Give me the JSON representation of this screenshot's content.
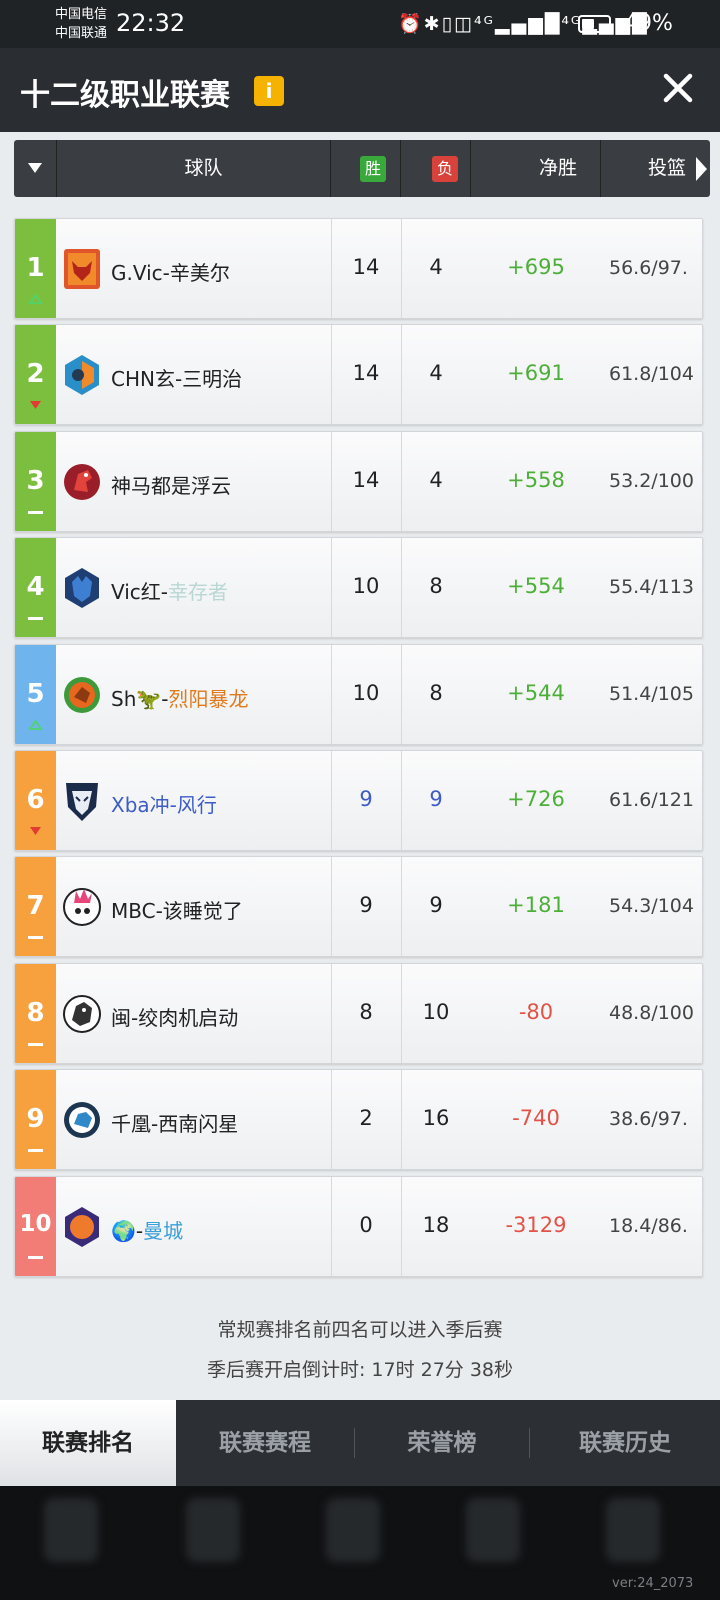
{
  "status_bar": {
    "carrier_1": "中国电信",
    "carrier_2": "中国联通",
    "time": "22:32",
    "icons": "⏰✱▯◫⁴ᴳ▂▄▆█⁴ᴳ▂▄▆█",
    "battery_percent": "49%",
    "battery_level": 0.49
  },
  "header": {
    "title": "十二级职业联赛",
    "info_label": "i"
  },
  "table_header": {
    "team": "球队",
    "wins": "胜",
    "losses": "负",
    "net": "净胜",
    "fg": "投篮"
  },
  "colors": {
    "tier_green": "#7cbf3e",
    "tier_blue": "#6fb4ec",
    "tier_orange": "#f6a13e",
    "tier_red": "#f27d76",
    "positive": "#4caf37",
    "negative": "#e35246"
  },
  "rows": [
    {
      "rank": "1",
      "trend": "up",
      "tier": "green",
      "logo": "red-bull-logo",
      "name": "G.Vic-辛美尔",
      "name_suffix": "",
      "wins": "14",
      "losses": "4",
      "net": "+695",
      "fg": "56.6/97."
    },
    {
      "rank": "2",
      "trend": "down",
      "tier": "green",
      "logo": "blue-orange-hex-logo",
      "name": "CHN玄-三明治",
      "name_suffix": "",
      "wins": "14",
      "losses": "4",
      "net": "+691",
      "fg": "61.8/104"
    },
    {
      "rank": "3",
      "trend": "same",
      "tier": "green",
      "logo": "red-horse-logo",
      "name": "神马都是浮云",
      "name_suffix": "",
      "wins": "14",
      "losses": "4",
      "net": "+558",
      "fg": "53.2/100"
    },
    {
      "rank": "4",
      "trend": "same",
      "tier": "green",
      "logo": "blue-wolf-logo",
      "name": "Vic红-",
      "name_suffix": "幸存者",
      "wins": "10",
      "losses": "8",
      "net": "+554",
      "fg": "55.4/113"
    },
    {
      "rank": "5",
      "trend": "up",
      "tier": "blue",
      "logo": "green-dino-logo",
      "name": "Sh🦖-",
      "name_suffix": "烈阳暴龙",
      "wins": "10",
      "losses": "8",
      "net": "+544",
      "fg": "51.4/105"
    },
    {
      "rank": "6",
      "trend": "down",
      "tier": "orange",
      "logo": "navy-beast-logo",
      "name": "Xba冲-风行",
      "name_suffix": "",
      "wins": "9",
      "losses": "9",
      "net": "+726",
      "fg": "61.6/121"
    },
    {
      "rank": "7",
      "trend": "same",
      "tier": "orange",
      "logo": "punk-skull-logo",
      "name": "MBC-该睡觉了",
      "name_suffix": "",
      "wins": "9",
      "losses": "9",
      "net": "+181",
      "fg": "54.3/104"
    },
    {
      "rank": "8",
      "trend": "same",
      "tier": "orange",
      "logo": "white-beast-logo",
      "name": "闽-绞肉机启动",
      "name_suffix": "",
      "wins": "8",
      "losses": "10",
      "net": "-80",
      "fg": "48.8/100"
    },
    {
      "rank": "9",
      "trend": "same",
      "tier": "orange",
      "logo": "gear-wolf-logo",
      "name": "千凰-西南闪星",
      "name_suffix": "",
      "wins": "2",
      "losses": "16",
      "net": "-740",
      "fg": "38.6/97."
    },
    {
      "rank": "10",
      "trend": "same",
      "tier": "red",
      "logo": "purple-orange-hex-logo",
      "name": "🌍-",
      "name_suffix": "曼城",
      "wins": "0",
      "losses": "18",
      "net": "-3129",
      "fg": "18.4/86."
    }
  ],
  "notes": {
    "playoff": "常规赛排名前四名可以进入季后赛",
    "countdown": "季后赛开启倒计时:  17时 27分 38秒"
  },
  "tabs": [
    {
      "label": "联赛排名",
      "active": true
    },
    {
      "label": "联赛赛程",
      "active": false
    },
    {
      "label": "荣誉榜",
      "active": false
    },
    {
      "label": "联赛历史",
      "active": false
    }
  ],
  "version": "ver:24_2073"
}
